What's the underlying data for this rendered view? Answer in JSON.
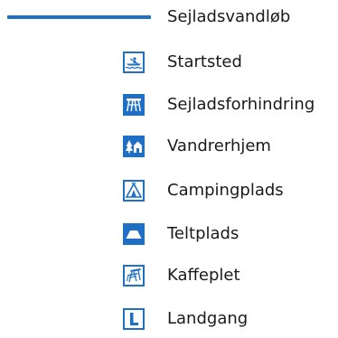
{
  "colors": {
    "route": "#1f6fc5",
    "icon_blue": "#1f6fc5",
    "icon_white": "#ffffff",
    "text": "#1a1a1a"
  },
  "legend": {
    "items": [
      {
        "label": "Sejladsvandløb",
        "symbol": "blue-route-line"
      },
      {
        "label": "Startsted",
        "icon": "canoe-launch-icon"
      },
      {
        "label": "Sejladsforhindring",
        "icon": "obstacle-icon"
      },
      {
        "label": "Vandrerhjem",
        "icon": "hostel-icon"
      },
      {
        "label": "Campingplads",
        "icon": "tent-campsite-icon"
      },
      {
        "label": "Teltplads",
        "icon": "tent-pitch-icon"
      },
      {
        "label": "Kaffeplet",
        "icon": "picnic-table-icon"
      },
      {
        "label": "Landgang",
        "icon": "landing-icon"
      }
    ]
  }
}
